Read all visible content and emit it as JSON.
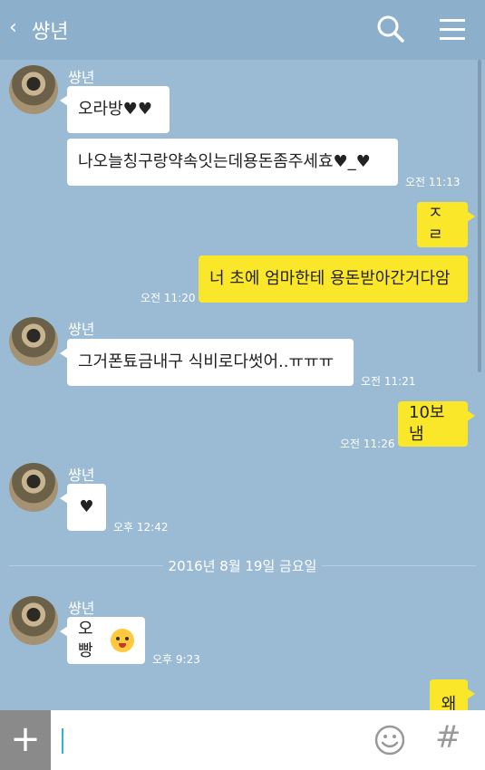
{
  "header": {
    "back_icon": "chevron-left-icon",
    "title": "썅년"
  },
  "messages": [
    {
      "sender": "썅년",
      "lines": [
        "오라방♥♥",
        "나오늘칭구랑약속잇는데용돈좀주세효♥_♥"
      ],
      "time": "오전 11:13"
    },
    {
      "mine": true,
      "lines": [
        "ㅈㄹ",
        "너 초에 엄마한테 용돈받아간거다암"
      ],
      "time": "오전 11:20"
    },
    {
      "sender": "썅년",
      "lines": [
        "그거폰툐금내구 식비로다썻어..ㅠㅠㅠ"
      ],
      "time": "오전 11:21"
    },
    {
      "mine": true,
      "lines": [
        "10보냄"
      ],
      "time": "오전 11:26"
    },
    {
      "sender": "썅년",
      "lines": [
        "♥"
      ],
      "time": "오후 12:42"
    },
    {
      "sender": "썅년",
      "lines": [
        "오빵"
      ],
      "time": "오후 9:23",
      "emoji": "crying-face-emoji"
    },
    {
      "mine": true,
      "lines": [
        "왜"
      ]
    }
  ],
  "date_divider": "2016년 8월 19일 금요일",
  "composer": {
    "plus_label": "+",
    "hash_label": "#"
  }
}
